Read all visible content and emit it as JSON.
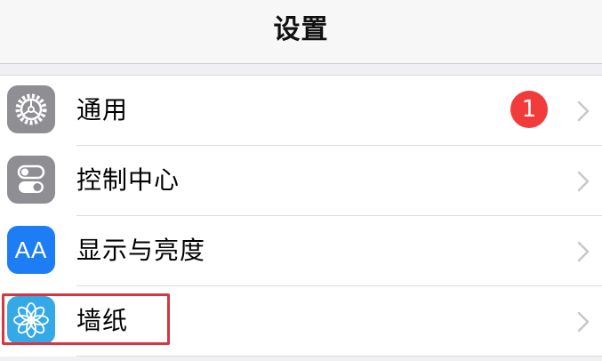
{
  "header": {
    "title": "设置"
  },
  "settings": {
    "items": [
      {
        "label": "通用",
        "icon": "gear-icon",
        "badge": "1"
      },
      {
        "label": "控制中心",
        "icon": "toggle-switches-icon"
      },
      {
        "label": "显示与亮度",
        "icon": "text-size-icon",
        "icon_text": "AA"
      },
      {
        "label": "墙纸",
        "icon": "flower-icon",
        "highlighted": true
      }
    ]
  },
  "colors": {
    "badge": "#f23b3b",
    "highlight_box": "#d9343f",
    "gray_icon": "#8e8e93",
    "blue_icon": "#1c7df5",
    "sky_icon": "#35a9e6"
  }
}
